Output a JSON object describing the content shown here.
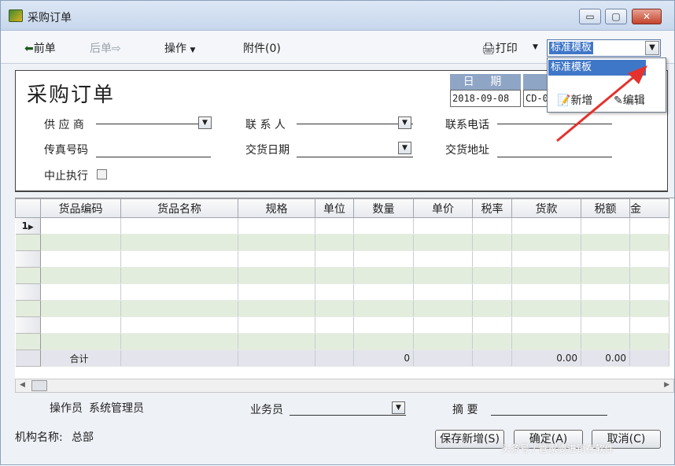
{
  "window": {
    "title": "采购订单",
    "controls": [
      "▭",
      "▢",
      "✕"
    ]
  },
  "toolbar": {
    "prev": "前单",
    "next": "后单",
    "ops": "操作",
    "attach": "附件(0)",
    "print": "打印",
    "template_value": "标准模板"
  },
  "template_dropdown": {
    "option": "标准模板",
    "new_label": "新增",
    "edit_label": "编辑"
  },
  "header": {
    "form_title": "采购订单",
    "date_label": "日 期",
    "date_value": "2018-09-08",
    "code_value": "CD-0",
    "supplier_label": "供 应 商",
    "contact_label": "联 系 人",
    "phone_label": "联系电话",
    "fax_label": "传真号码",
    "delivery_date_label": "交货日期",
    "delivery_addr_label": "交货地址",
    "suspend_label": "中止执行"
  },
  "grid": {
    "columns": [
      "货品编码",
      "货品名称",
      "规格",
      "单位",
      "数量",
      "单价",
      "税率",
      "货款",
      "税额",
      "金"
    ],
    "first_row_marker": "1",
    "total_label": "合计",
    "total_qty": "0",
    "total_amount": "0.00",
    "total_tax": "0.00"
  },
  "footer": {
    "operator_label": "操作员",
    "operator_value": "系统管理员",
    "salesman_label": "业务员",
    "summary_label": "摘 要",
    "org_label": "机构名称:",
    "org_value": "总部",
    "save_new": "保存新增(S)",
    "confirm": "确定(A)",
    "cancel": "取消(C)"
  },
  "watermark": "头条号 / 管家婆进销存软件",
  "colors": {
    "annotation_arrow": "#e5322d",
    "selection": "#3f77c8"
  }
}
